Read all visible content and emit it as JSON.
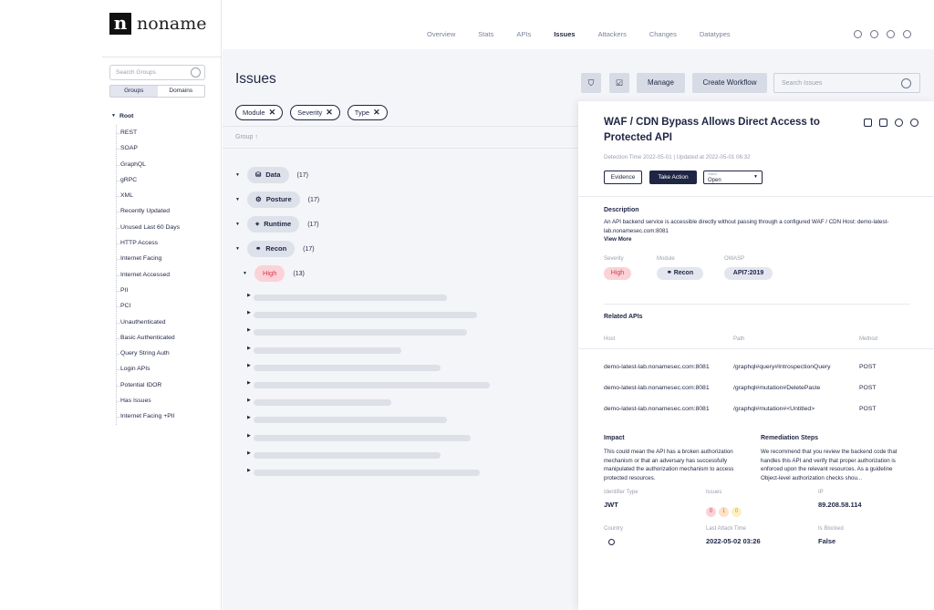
{
  "brand": {
    "logo_letter": "n",
    "name": "noname"
  },
  "sidebar": {
    "search_placeholder": "Search Groups",
    "tabs": [
      "Groups",
      "Domains"
    ],
    "root_label": "Root",
    "items": [
      "REST",
      "SOAP",
      "GraphQL",
      "gRPC",
      "XML",
      "Recently Updated",
      "Unused Last 60 Days",
      "HTTP Access",
      "Internet Facing",
      "Internet Accessed",
      "PII",
      "PCI",
      "Unauthenticated",
      "Basic Authenticated",
      "Query String Auth",
      "Login APIs",
      "Potential IDOR",
      "Has Issues",
      "Internet Facing +PII"
    ]
  },
  "nav": {
    "items": [
      "Overview",
      "Stats",
      "APIs",
      "Issues",
      "Attackers",
      "Changes",
      "Datatypes"
    ],
    "active": "Issues"
  },
  "page": {
    "title": "Issues",
    "manage_label": "Manage",
    "create_workflow_label": "Create Workflow",
    "search_placeholder": "Search Issues",
    "filters": [
      "Module",
      "Severity",
      "Type"
    ],
    "group_header": "Group ↑",
    "groups": [
      {
        "label": "Data",
        "count": "(17)",
        "icon": "database-icon"
      },
      {
        "label": "Posture",
        "count": "(17)",
        "icon": "gear-icon"
      },
      {
        "label": "Runtime",
        "count": "(17)",
        "icon": "crosshair-icon"
      },
      {
        "label": "Recon",
        "count": "(17)",
        "icon": "binoculars-icon"
      }
    ],
    "subgroup": {
      "label": "High",
      "count": "(13)"
    },
    "skeleton_rows": [
      0.59,
      0.68,
      0.65,
      0.45,
      0.57,
      0.72,
      0.42,
      0.59,
      0.66,
      0.57,
      0.69
    ]
  },
  "detail": {
    "title": "WAF / CDN Bypass Allows Direct Access to Protected API",
    "time": "Detection Time 2022-05-01 | Updated at 2022-05-01 06:32",
    "evidence_label": "Evidence",
    "take_action_label": "Take Action",
    "status_label": "Status",
    "status_value": "Open",
    "description_heading": "Description",
    "description": "An API backend service is accessible directly without passing through a configured WAF / CDN Host: demo-latest-lab.nonamesec.com:8081",
    "view_more": "View More",
    "severity_label": "Severity",
    "severity_value": "High",
    "module_label": "Module",
    "module_value": "Recon",
    "owasp_label": "OWASP",
    "owasp_value": "API7:2019",
    "related_heading": "Related APIs",
    "columns": [
      "Host",
      "Path",
      "Method"
    ],
    "rows": [
      {
        "host": "demo-latest-lab.nonamesec.com:8081",
        "path": "/graphql#query#IntrospectionQuery",
        "method": "POST"
      },
      {
        "host": "demo-latest-lab.nonamesec.com:8081",
        "path": "/graphql#mutation#DeletePaste",
        "method": "POST"
      },
      {
        "host": "demo-latest-lab.nonamesec.com:8081",
        "path": "/graphql#mutation#<Untitled>",
        "method": "POST"
      }
    ],
    "impact_heading": "Impact",
    "impact": "This could mean the API has a broken authorization mechanism or that an adversary has successfully manipulated the authorization mechanism to access protected resources.",
    "remediation_heading": "Remediation Steps",
    "remediation": "We recommend that you review the backend code that handles this API and verify that proper authorization is enforced upon the relevant resources. As a guideline Object-level authorization checks shou...",
    "identifier_label": "Identifier Type",
    "identifier_value": "JWT",
    "issues_label": "Issues",
    "issues_counts": [
      "0",
      "1",
      "0"
    ],
    "ip_label": "IP",
    "ip_value": "89.208.58.114",
    "country_label": "Country",
    "last_attack_label": "Last Attack Time",
    "last_attack_value": "2022-05-02 03:26",
    "blocked_label": "Is Blocked",
    "blocked_value": "False"
  }
}
